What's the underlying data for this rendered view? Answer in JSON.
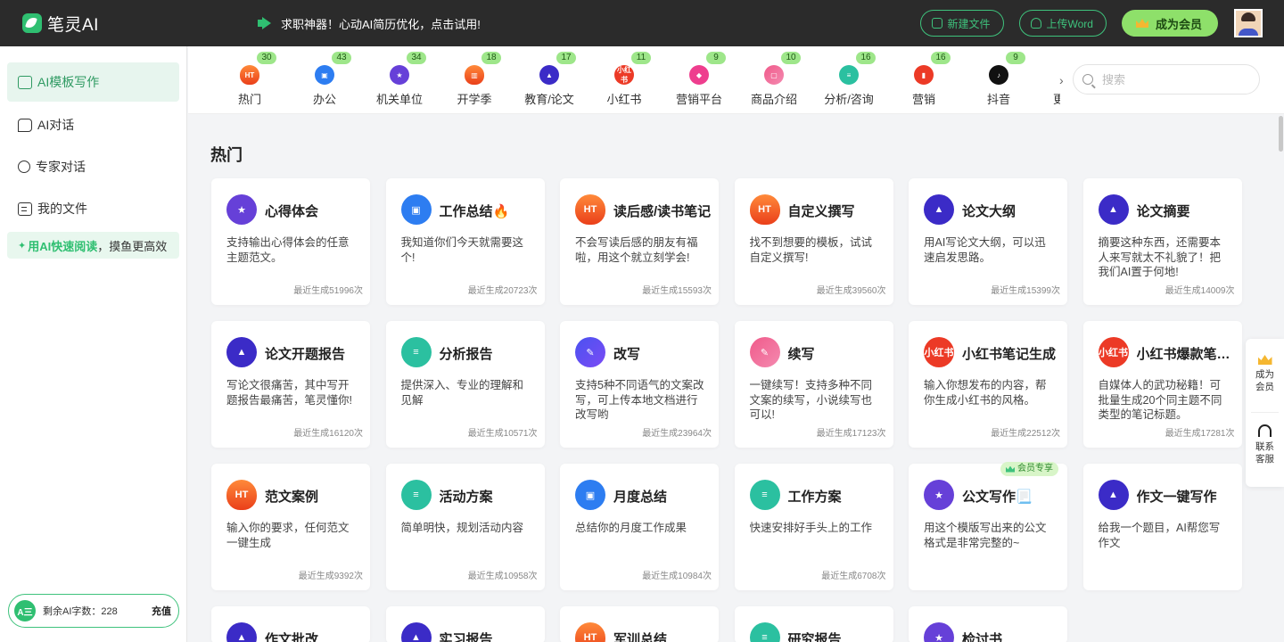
{
  "header": {
    "brand": "笔灵AI",
    "promo": "求职神器！心动AI简历优化，点击试用!",
    "new_file": "新建文件",
    "upload_word": "上传Word",
    "vip": "成为会员"
  },
  "sidebar": {
    "items": [
      {
        "label": "AI模板写作"
      },
      {
        "label": "AI对话"
      },
      {
        "label": "专家对话"
      },
      {
        "label": "我的文件"
      }
    ],
    "promo_highlight": "用AI快速阅读",
    "promo_rest": "，摸鱼更高效",
    "quota_icon": "A三",
    "quota_text": "剩余AI字数：228",
    "quota_button": "充值"
  },
  "categories": [
    {
      "label": "热门",
      "badge": "30",
      "icon": "HT",
      "color": "i-orange"
    },
    {
      "label": "办公",
      "badge": "43",
      "icon": "▣",
      "color": "i-blue"
    },
    {
      "label": "机关单位",
      "badge": "34",
      "icon": "★",
      "color": "i-purple"
    },
    {
      "label": "开学季",
      "badge": "18",
      "icon": "▥",
      "color": "i-orange"
    },
    {
      "label": "教育/论文",
      "badge": "17",
      "icon": "▲",
      "color": "i-navy"
    },
    {
      "label": "小红书",
      "badge": "11",
      "icon": "小红书",
      "color": "i-red"
    },
    {
      "label": "营销平台",
      "badge": "9",
      "icon": "◆",
      "color": "i-magenta"
    },
    {
      "label": "商品介绍",
      "badge": "10",
      "icon": "▢",
      "color": "i-pink"
    },
    {
      "label": "分析/咨询",
      "badge": "16",
      "icon": "≡",
      "color": "i-teal"
    },
    {
      "label": "营销",
      "badge": "16",
      "icon": "▮",
      "color": "i-red"
    },
    {
      "label": "抖音",
      "badge": "9",
      "icon": "♪",
      "color": "i-black"
    }
  ],
  "category_overflow": "更",
  "search": {
    "placeholder": "搜索"
  },
  "section_title": "热门",
  "cards": [
    {
      "title": "心得体会",
      "desc": "支持输出心得体会的任意主题范文。",
      "count": "最近生成51996次",
      "icon": "★",
      "color": "i-purple"
    },
    {
      "title": "工作总结🔥",
      "desc": "我知道你们今天就需要这个!",
      "count": "最近生成20723次",
      "icon": "▣",
      "color": "i-blue"
    },
    {
      "title": "读后感/读书笔记",
      "desc": "不会写读后感的朋友有福啦，用这个就立刻学会!",
      "count": "最近生成15593次",
      "icon": "HT",
      "color": "i-orange"
    },
    {
      "title": "自定义撰写",
      "desc": "找不到想要的模板，试试自定义撰写!",
      "count": "最近生成39560次",
      "icon": "HT",
      "color": "i-orange"
    },
    {
      "title": "论文大纲",
      "desc": "用AI写论文大纲，可以迅速启发思路。",
      "count": "最近生成15399次",
      "icon": "▲",
      "color": "i-navy"
    },
    {
      "title": "论文摘要",
      "desc": "摘要这种东西，还需要本人来写就太不礼貌了！把我们AI置于何地!",
      "count": "最近生成14009次",
      "icon": "▲",
      "color": "i-navy"
    },
    {
      "title": "论文开题报告",
      "desc": "写论文很痛苦，其中写开题报告最痛苦，笔灵懂你!",
      "count": "最近生成16120次",
      "icon": "▲",
      "color": "i-navy"
    },
    {
      "title": "分析报告",
      "desc": "提供深入、专业的理解和见解",
      "count": "最近生成10571次",
      "icon": "≡",
      "color": "i-teal"
    },
    {
      "title": "改写",
      "desc": "支持5种不同语气的文案改写，可上传本地文档进行改写哟",
      "count": "最近生成23964次",
      "icon": "✎",
      "color": "i-indigo"
    },
    {
      "title": "续写",
      "desc": "一键续写！支持多种不同文案的续写，小说续写也可以!",
      "count": "最近生成17123次",
      "icon": "✎",
      "color": "i-pink"
    },
    {
      "title": "小红书笔记生成",
      "desc": "输入你想发布的内容，帮你生成小红书的风格。",
      "count": "最近生成22512次",
      "icon": "小红书",
      "color": "i-red"
    },
    {
      "title": "小红书爆款笔记标题",
      "desc": "自媒体人的武功秘籍！可批量生成20个同主题不同类型的笔记标题。",
      "count": "最近生成17281次",
      "icon": "小红书",
      "color": "i-red"
    },
    {
      "title": "范文案例",
      "desc": "输入你的要求，任何范文一键生成",
      "count": "最近生成9392次",
      "icon": "HT",
      "color": "i-orange"
    },
    {
      "title": "活动方案",
      "desc": "简单明快，规划活动内容",
      "count": "最近生成10958次",
      "icon": "≡",
      "color": "i-teal"
    },
    {
      "title": "月度总结",
      "desc": "总结你的月度工作成果",
      "count": "最近生成10984次",
      "icon": "▣",
      "color": "i-blue"
    },
    {
      "title": "工作方案",
      "desc": "快速安排好手头上的工作",
      "count": "最近生成6708次",
      "icon": "≡",
      "color": "i-teal"
    },
    {
      "title": "公文写作📃",
      "desc": "用这个模版写出来的公文格式是非常完整的~",
      "count": "",
      "icon": "★",
      "color": "i-purple",
      "tag": "会员专享"
    },
    {
      "title": "作文一键写作",
      "desc": "给我一个题目，AI帮您写作文",
      "count": "",
      "icon": "▲",
      "color": "i-navy"
    },
    {
      "title": "作文批改",
      "desc": "",
      "count": "",
      "icon": "▲",
      "color": "i-navy"
    },
    {
      "title": "实习报告",
      "desc": "",
      "count": "",
      "icon": "▲",
      "color": "i-navy"
    },
    {
      "title": "军训总结",
      "desc": "",
      "count": "",
      "icon": "HT",
      "color": "i-orange"
    },
    {
      "title": "研究报告",
      "desc": "",
      "count": "",
      "icon": "≡",
      "color": "i-teal"
    },
    {
      "title": "检讨书",
      "desc": "",
      "count": "",
      "icon": "★",
      "color": "i-purple"
    },
    {
      "title": "",
      "desc": "",
      "count": "",
      "icon": "",
      "color": ""
    }
  ],
  "float": {
    "vip": "成为会员",
    "service": "联系客服"
  }
}
